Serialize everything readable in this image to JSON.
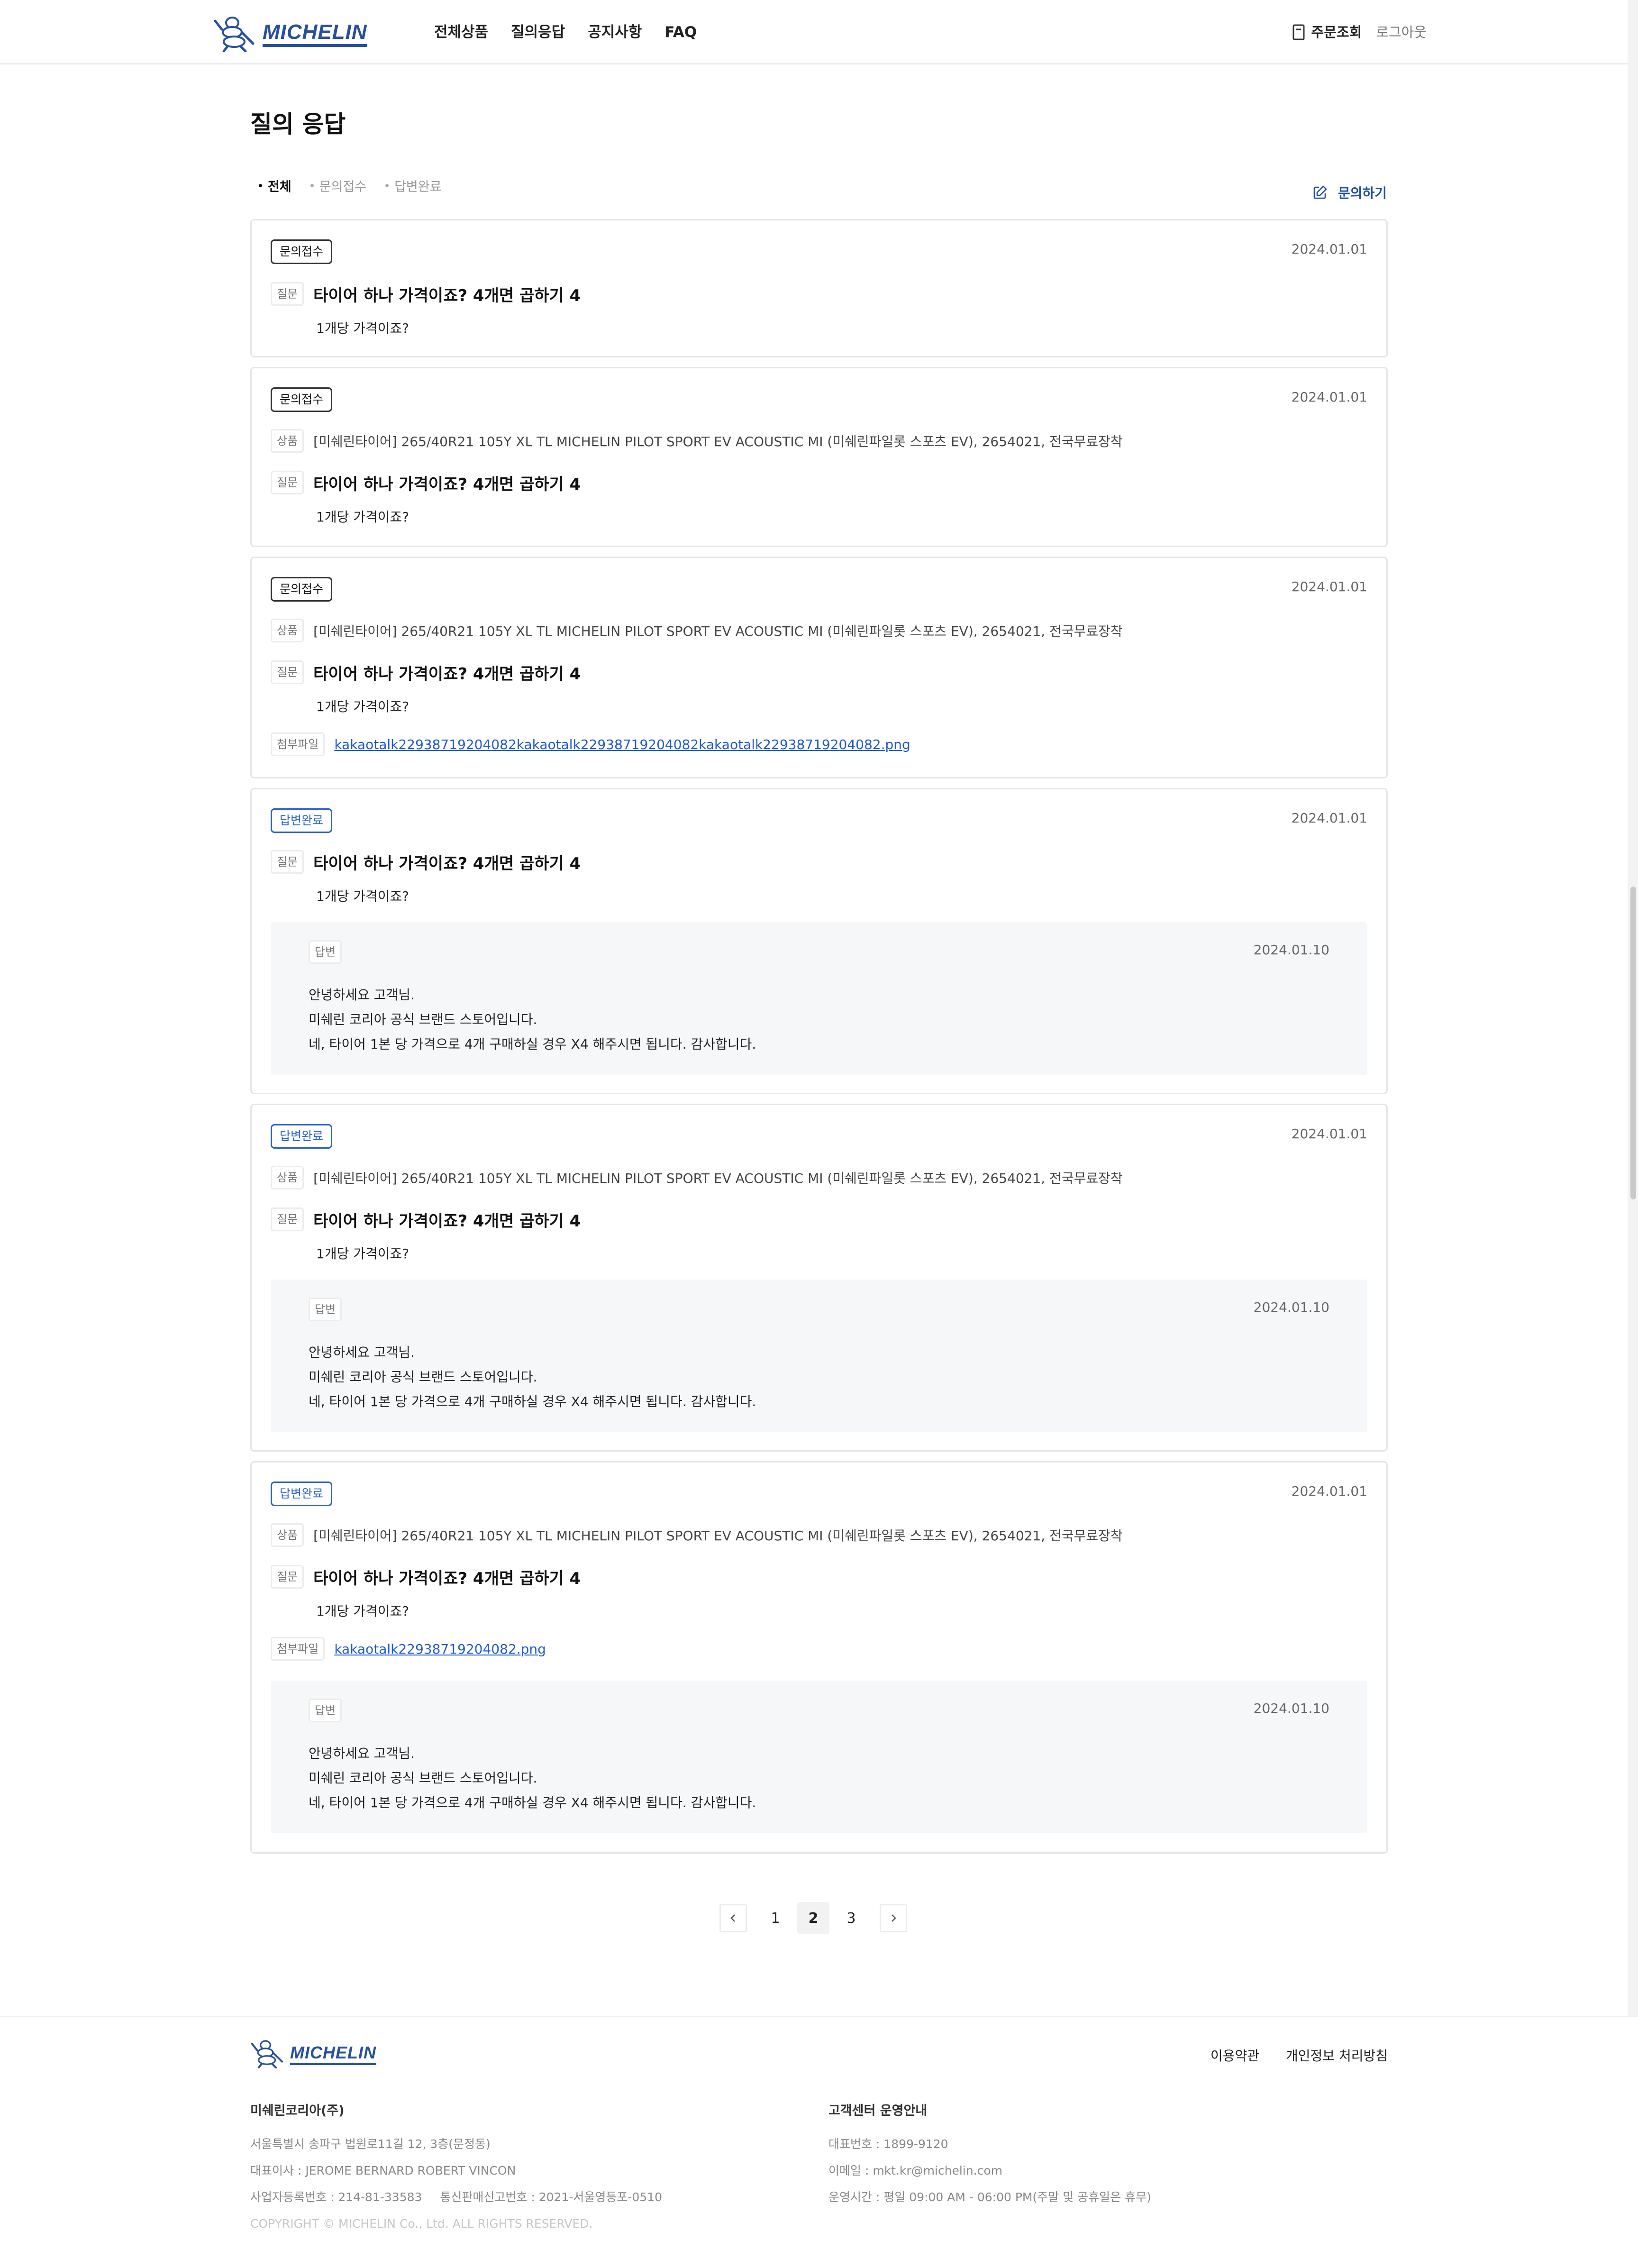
{
  "header": {
    "brand": "MICHELIN",
    "nav": [
      "전체상품",
      "질의응답",
      "공지사항",
      "FAQ"
    ],
    "order_label": "주문조회",
    "logout_label": "로그아웃"
  },
  "page": {
    "title": "질의 응답",
    "filters": [
      "전체",
      "문의접수",
      "답변완료"
    ],
    "active_filter": "전체",
    "ask_label": "문의하기"
  },
  "labels": {
    "product": "상품",
    "question": "질문",
    "answer": "답변",
    "attachment": "첨부파일"
  },
  "items": [
    {
      "status": "문의접수",
      "date": "2024.01.01",
      "title": "타이어 하나 가격이죠? 4개면 곱하기 4",
      "body": "1개당 가격이죠?"
    },
    {
      "status": "문의접수",
      "date": "2024.01.01",
      "product": "[미쉐린타이어] 265/40R21 105Y XL TL MICHELIN PILOT SPORT EV ACOUSTIC MI (미쉐린파일롯 스포츠 EV), 2654021, 전국무료장착",
      "title": "타이어 하나 가격이죠? 4개면 곱하기 4",
      "body": "1개당 가격이죠?"
    },
    {
      "status": "문의접수",
      "date": "2024.01.01",
      "product": "[미쉐린타이어] 265/40R21 105Y XL TL MICHELIN PILOT SPORT EV ACOUSTIC MI (미쉐린파일롯 스포츠 EV), 2654021, 전국무료장착",
      "title": "타이어 하나 가격이죠? 4개면 곱하기 4",
      "body": "1개당 가격이죠?",
      "file": "kakaotalk22938719204082kakaotalk22938719204082kakaotalk22938719204082.png"
    },
    {
      "status": "답변완료",
      "date": "2024.01.01",
      "title": "타이어 하나 가격이죠? 4개면 곱하기 4",
      "body": "1개당 가격이죠?",
      "answer": {
        "date": "2024.01.10",
        "lines": [
          "안녕하세요 고객님.",
          "미쉐린 코리아 공식 브랜드 스토어입니다.",
          "네, 타이어 1본 당 가격으로 4개 구매하실 경우 X4 해주시면 됩니다. 감사합니다."
        ]
      }
    },
    {
      "status": "답변완료",
      "date": "2024.01.01",
      "product": "[미쉐린타이어] 265/40R21 105Y XL TL MICHELIN PILOT SPORT EV ACOUSTIC MI (미쉐린파일롯 스포츠 EV), 2654021, 전국무료장착",
      "title": "타이어 하나 가격이죠? 4개면 곱하기 4",
      "body": "1개당 가격이죠?",
      "answer": {
        "date": "2024.01.10",
        "lines": [
          "안녕하세요 고객님.",
          "미쉐린 코리아 공식 브랜드 스토어입니다.",
          "네, 타이어 1본 당 가격으로 4개 구매하실 경우 X4 해주시면 됩니다. 감사합니다."
        ]
      }
    },
    {
      "status": "답변완료",
      "date": "2024.01.01",
      "product": "[미쉐린타이어] 265/40R21 105Y XL TL MICHELIN PILOT SPORT EV ACOUSTIC MI (미쉐린파일롯 스포츠 EV), 2654021, 전국무료장착",
      "title": "타이어 하나 가격이죠? 4개면 곱하기 4",
      "body": "1개당 가격이죠?",
      "file": "kakaotalk22938719204082.png",
      "answer": {
        "date": "2024.01.10",
        "lines": [
          "안녕하세요 고객님.",
          "미쉐린 코리아 공식 브랜드 스토어입니다.",
          "네, 타이어 1본 당 가격으로 4개 구매하실 경우 X4 해주시면 됩니다. 감사합니다."
        ]
      }
    }
  ],
  "pagination": {
    "pages": [
      "1",
      "2",
      "3"
    ],
    "current": "2"
  },
  "footer": {
    "brand": "MICHELIN",
    "links": [
      "이용약관",
      "개인정보 처리방침"
    ],
    "company": {
      "name": "미쉐린코리아(주)",
      "address": "서울특별시 송파구 법원로11길 12, 3층(문정동)",
      "ceo": "대표이사 : JEROME BERNARD ROBERT VINCON",
      "biz_no": "사업자등록번호 : 214-81-33583",
      "mail_order_no": "통신판매신고번호 : 2021-서울영등포-0510",
      "copyright": "COPYRIGHT © MICHELIN Co., Ltd. ALL RIGHTS RESERVED."
    },
    "support": {
      "title": "고객센터 운영안내",
      "phone": "대표번호 : 1899-9120",
      "email": "이메일 : mkt.kr@michelin.com",
      "hours": "운영시간 : 평일 09:00 AM - 06:00 PM(주말 및 공휴일은 휴무)"
    }
  },
  "colors": {
    "brand_blue": "#27509b",
    "link_blue": "#1e5bd0",
    "done_badge": "#2a62c8"
  }
}
